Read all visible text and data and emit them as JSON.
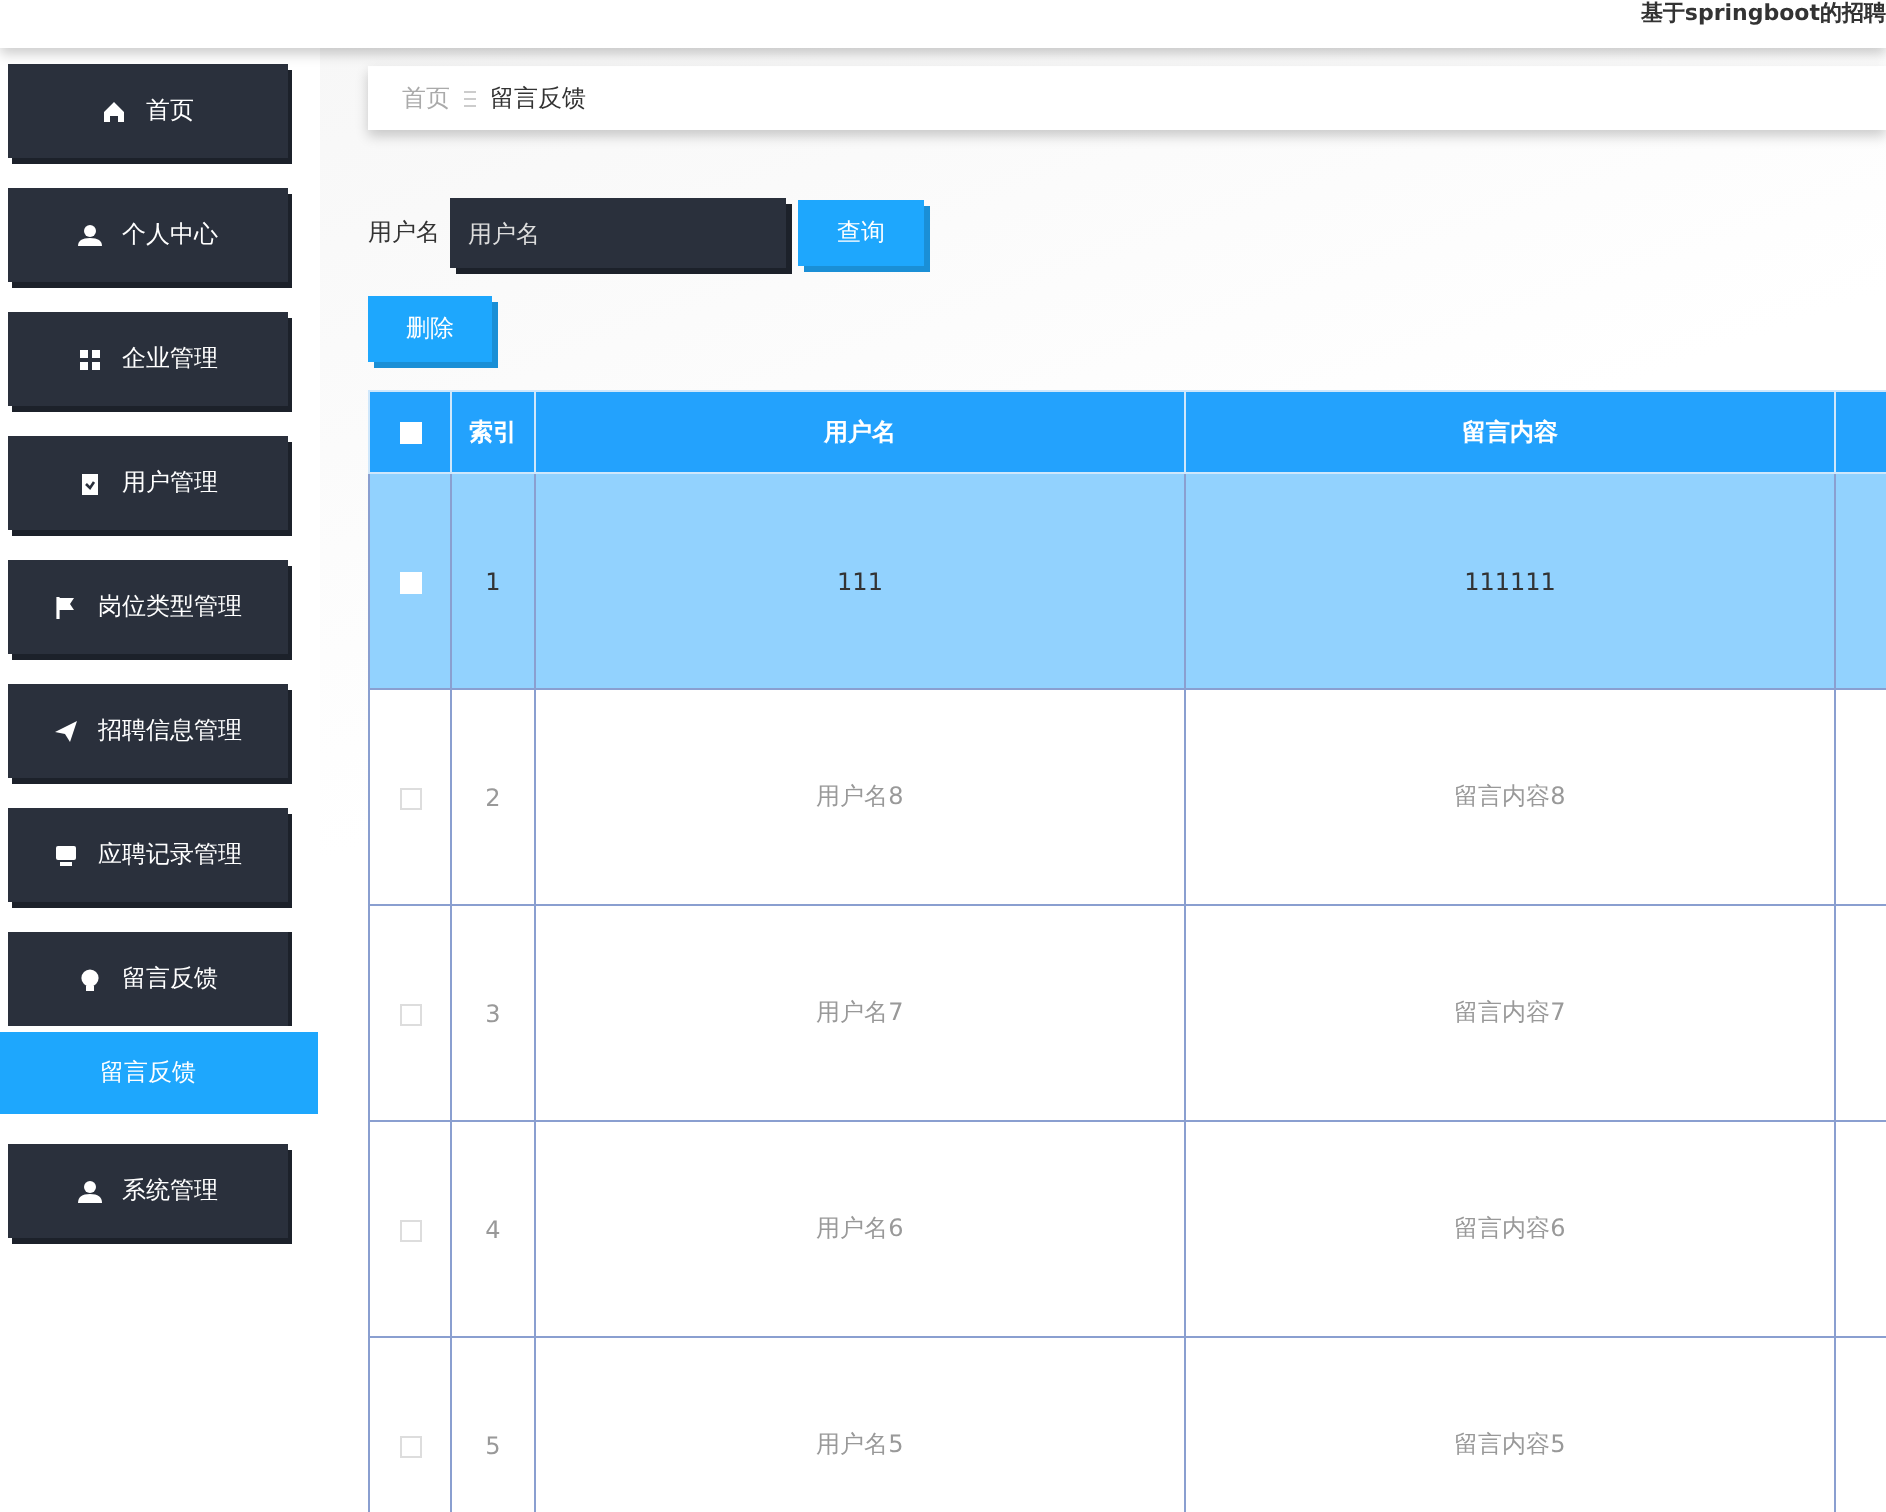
{
  "header": {
    "title": "基于springboot的招聘"
  },
  "sidebar": {
    "items": [
      {
        "label": "首页",
        "expanded": false
      },
      {
        "label": "个人中心",
        "expanded": false
      },
      {
        "label": "企业管理",
        "expanded": false
      },
      {
        "label": "用户管理",
        "expanded": false
      },
      {
        "label": "岗位类型管理",
        "expanded": false
      },
      {
        "label": "招聘信息管理",
        "expanded": false
      },
      {
        "label": "应聘记录管理",
        "expanded": false
      },
      {
        "label": "留言反馈",
        "expanded": true,
        "children": [
          {
            "label": "留言反馈",
            "selected": true
          }
        ]
      },
      {
        "label": "系统管理",
        "expanded": false
      }
    ]
  },
  "breadcrumb": [
    "首页",
    "留言反馈"
  ],
  "search": {
    "label": "用户名",
    "placeholder": "用户名",
    "button": "查询"
  },
  "delete_button": "删除",
  "table": {
    "select_all": {
      "checked": false
    },
    "columns": [
      "索引",
      "用户名",
      "留言内容"
    ],
    "rows": [
      {
        "index": "1",
        "username": "111",
        "content": "111111",
        "selected": true,
        "checked": false
      },
      {
        "index": "2",
        "username": "用户名8",
        "content": "留言内容8",
        "selected": false,
        "checked": false
      },
      {
        "index": "3",
        "username": "用户名7",
        "content": "留言内容7",
        "selected": false,
        "checked": false
      },
      {
        "index": "4",
        "username": "用户名6",
        "content": "留言内容6",
        "selected": false,
        "checked": false
      },
      {
        "index": "5",
        "username": "用户名5",
        "content": "留言内容5",
        "selected": false,
        "checked": false
      }
    ]
  }
}
